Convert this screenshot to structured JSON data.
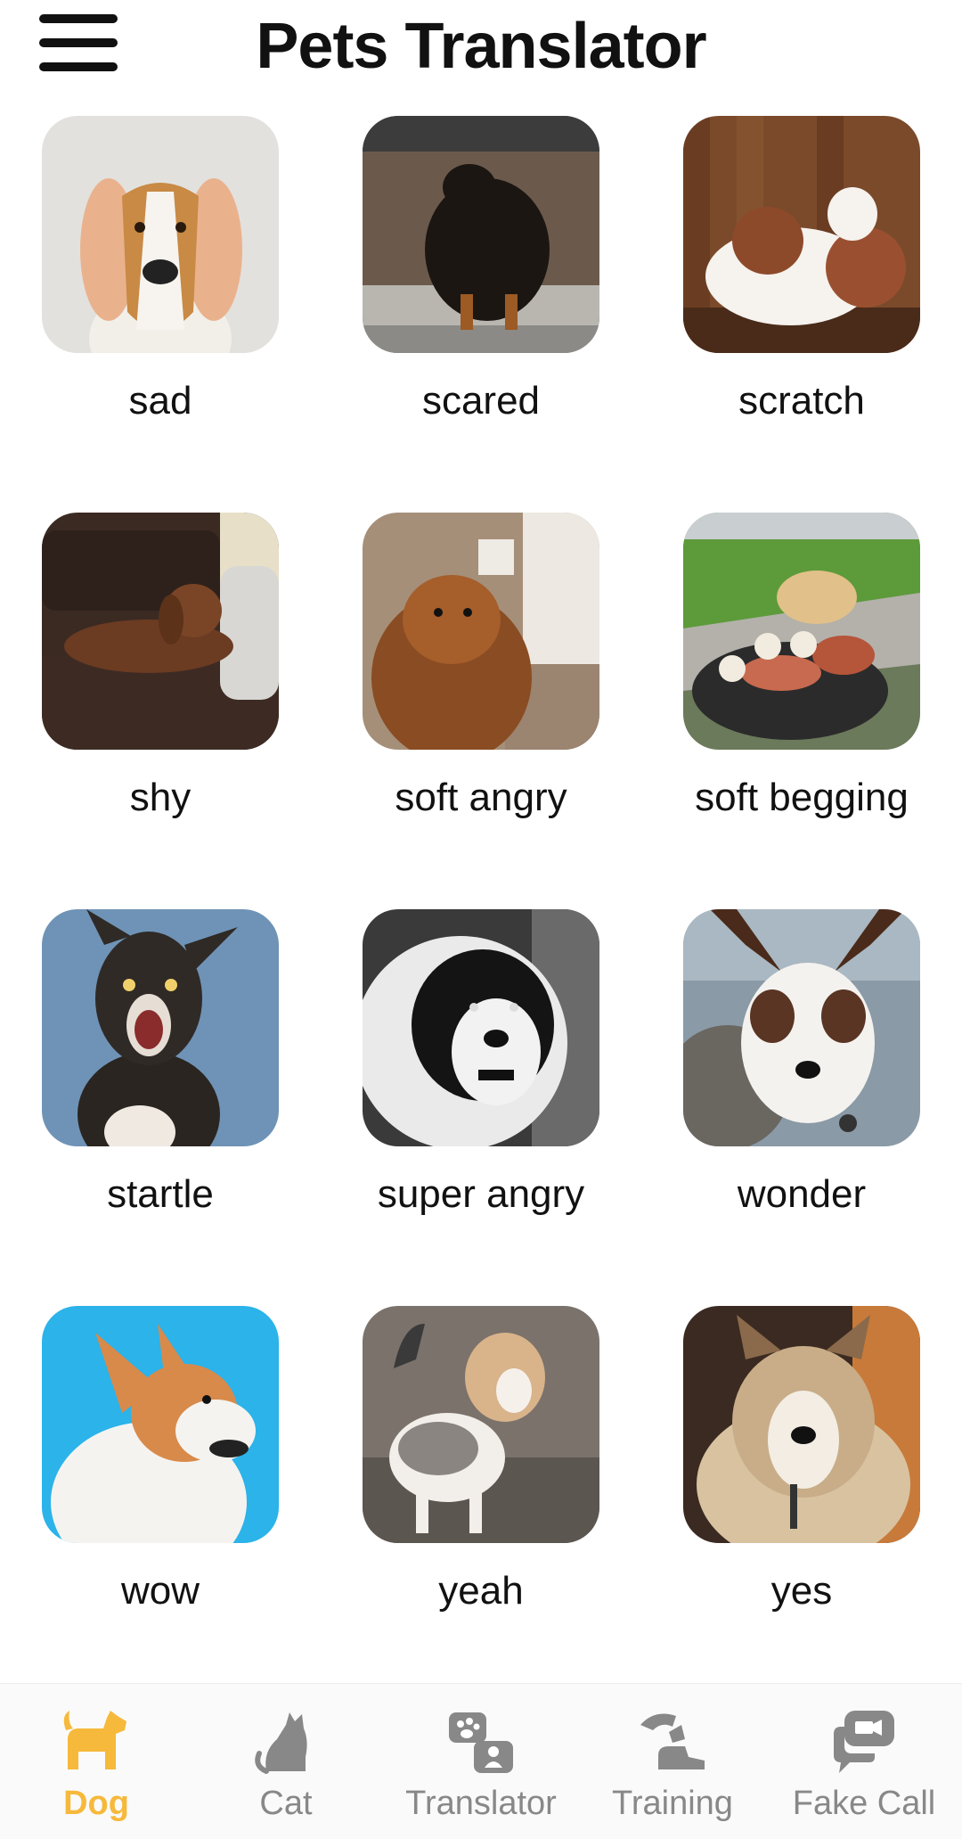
{
  "header": {
    "title": "Pets Translator",
    "menu_icon": "hamburger-menu-icon"
  },
  "sounds": [
    {
      "label": "sad",
      "image": "dog-covered-ears-photo"
    },
    {
      "label": "scared",
      "image": "black-puppy-photo"
    },
    {
      "label": "scratch",
      "image": "puppy-scratching-photo"
    },
    {
      "label": "shy",
      "image": "dog-on-sofa-photo"
    },
    {
      "label": "soft angry",
      "image": "pomeranian-photo"
    },
    {
      "label": "soft begging",
      "image": "dog-at-grill-photo"
    },
    {
      "label": "startle",
      "image": "surprised-dog-photo"
    },
    {
      "label": "super angry",
      "image": "growling-dog-bw-photo"
    },
    {
      "label": "wonder",
      "image": "corgi-mix-photo"
    },
    {
      "label": "wow",
      "image": "corgi-side-photo"
    },
    {
      "label": "yeah",
      "image": "beagle-puppy-photo"
    },
    {
      "label": "yes",
      "image": "husky-mix-photo"
    }
  ],
  "nav": {
    "items": [
      {
        "label": "Dog",
        "icon": "dog-icon",
        "active": true
      },
      {
        "label": "Cat",
        "icon": "cat-icon",
        "active": false
      },
      {
        "label": "Translator",
        "icon": "translator-icon",
        "active": false
      },
      {
        "label": "Training",
        "icon": "training-icon",
        "active": false
      },
      {
        "label": "Fake Call",
        "icon": "fake-call-icon",
        "active": false
      }
    ],
    "active_color": "#F6B93B",
    "inactive_color": "#888888"
  }
}
